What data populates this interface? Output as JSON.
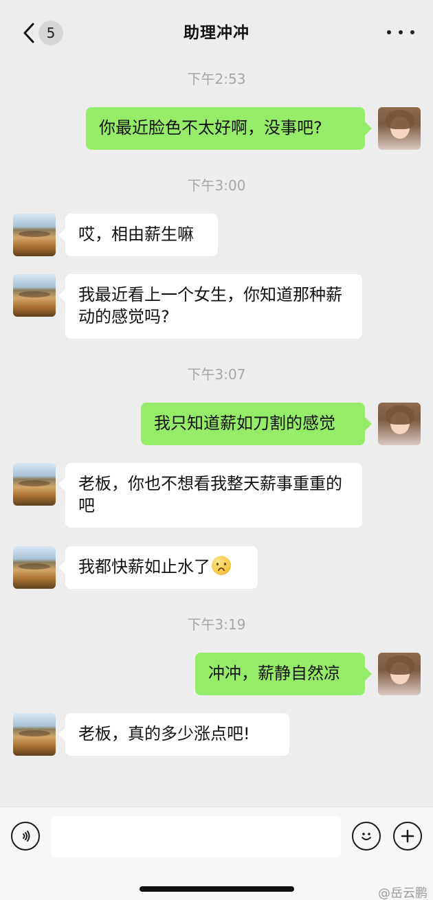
{
  "header": {
    "unread_badge": "5",
    "title": "助理冲冲"
  },
  "icons": {
    "back": "chevron-left-icon",
    "more": "more-icon",
    "voice": "voice-icon",
    "emoji": "emoji-icon",
    "plus": "plus-icon"
  },
  "timestamps": [
    "下午2:53",
    "下午3:00",
    "下午3:07",
    "下午3:19"
  ],
  "messages": [
    {
      "side": "right",
      "text": "你最近脸色不太好啊，没事吧?"
    },
    {
      "side": "left",
      "text": "哎，相由薪生嘛"
    },
    {
      "side": "left",
      "text": "我最近看上一个女生，你知道那种薪动的感觉吗?"
    },
    {
      "side": "right",
      "text": "我只知道薪如刀割的感觉"
    },
    {
      "side": "left",
      "text": "老板，你也不想看我整天薪事重重的吧"
    },
    {
      "side": "left",
      "text": "我都快薪如止水了",
      "emoji": "pleading-face"
    },
    {
      "side": "right",
      "text": "冲冲，薪静自然凉"
    },
    {
      "side": "left",
      "text": "老板，真的多少涨点吧!"
    }
  ],
  "composer": {
    "input_value": "",
    "watermark": "@岳云鹏"
  },
  "colors": {
    "background": "#ededed",
    "outgoing_bubble": "#95ec69",
    "incoming_bubble": "#ffffff",
    "timestamp": "#a6a6a6"
  }
}
